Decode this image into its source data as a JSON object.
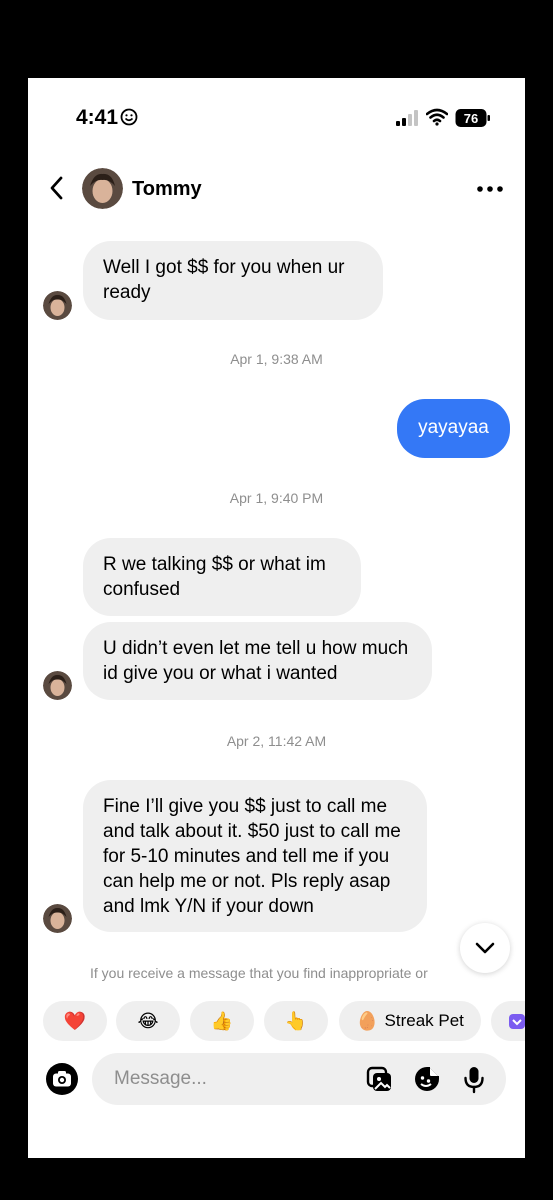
{
  "status_bar": {
    "time": "4:41",
    "battery": "76"
  },
  "header": {
    "contact_name": "Tommy"
  },
  "messages": [
    {
      "text": "Well I got $$ for you when ur ready"
    },
    {
      "text": "yayayaa"
    },
    {
      "text": "R we talking $$ or what im confused"
    },
    {
      "text": "U didn’t even let me tell u how much id give you or what i wanted"
    },
    {
      "text": "Fine I’ll give you $$ just to call me and talk about it. $50 just to call me for 5-10 minutes and tell me if you can help me or not. Pls reply asap and lmk Y/N if your down"
    }
  ],
  "timestamps": [
    "Apr 1, 9:38 AM",
    "Apr 1, 9:40 PM",
    "Apr 2, 11:42 AM"
  ],
  "notice": "If you receive a message that you find inappropriate or",
  "reactions": [
    {
      "emoji": "❤️",
      "icon": "heart-icon"
    },
    {
      "emoji": "😂",
      "icon": "laughing-icon"
    },
    {
      "emoji": "👍",
      "icon": "thumbs-up-icon"
    },
    {
      "emoji": "👆",
      "icon": "pointing-up-icon"
    },
    {
      "emoji": "🥚",
      "label": "Streak Pet",
      "icon": "streak-pet-icon"
    }
  ],
  "composer": {
    "placeholder": "Message..."
  },
  "colors": {
    "outgoing_bubble": "#3478f6",
    "incoming_bubble": "#efefef",
    "timestamp": "#8e8e8e",
    "battery": "#ffffff"
  }
}
